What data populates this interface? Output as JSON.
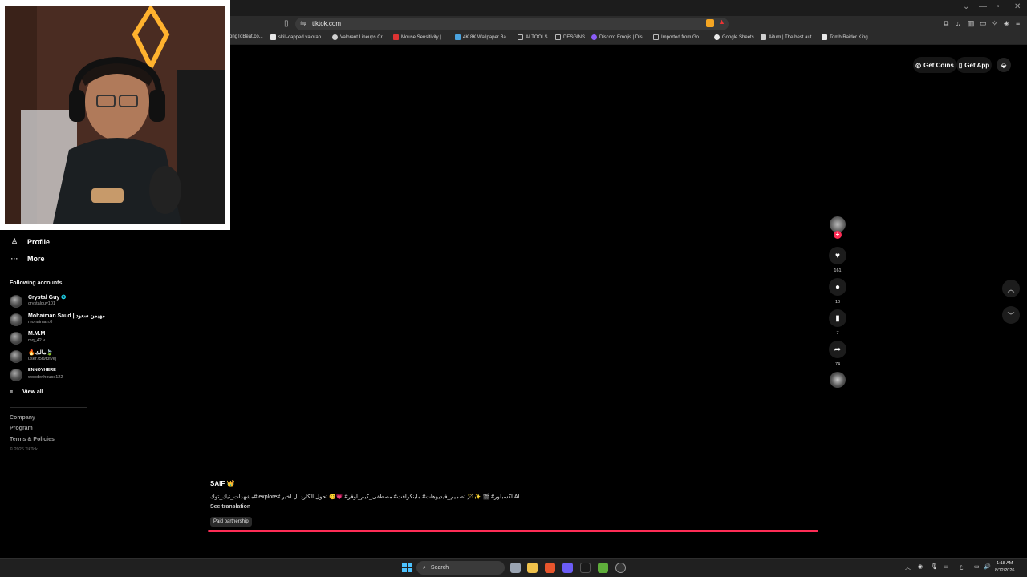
{
  "browser": {
    "url": "tiktok.com",
    "bookmarks": [
      {
        "label": "ongToBeat.co...",
        "color": "#333"
      },
      {
        "label": "skill-capped valoran...",
        "color": "#e8e8e8"
      },
      {
        "label": "Valorant Lineups Cr...",
        "color": "#cfcfcf"
      },
      {
        "label": "Mouse Sensitivity |...",
        "color": "#d33"
      },
      {
        "label": "4K 8K Wallpaper Ba...",
        "color": "#4aa3df"
      },
      {
        "label": "AI TOOLS",
        "color": "#888"
      },
      {
        "label": "DESGINS",
        "color": "#888"
      },
      {
        "label": "Discord Emojis | Dis...",
        "color": "#8a5cf6"
      },
      {
        "label": "Imported from Go...",
        "color": "#888"
      },
      {
        "label": "Google Sheets",
        "color": "#e8e8e8"
      },
      {
        "label": "Aitum | The best aut...",
        "color": "#cfcfcf"
      },
      {
        "label": "Tomb Raider King ...",
        "color": "#e8e8e8"
      }
    ]
  },
  "header": {
    "get_coins": "Get Coins",
    "get_app": "Get App"
  },
  "sidebar": {
    "profile": "Profile",
    "more": "More",
    "following_title": "Following accounts",
    "accounts": [
      {
        "name": "Crystal Guy",
        "username": "crystalguy101",
        "verified": true
      },
      {
        "name": "Mohaiman Saud | مهيمن سعود",
        "username": "mohaiman.0"
      },
      {
        "name": "M.M.M",
        "username": "mq_42.v"
      },
      {
        "name": "🔥مالك🍃",
        "username": "user75r9t3fvej"
      },
      {
        "name": "ENNOYHERE",
        "username": "woodenhouse122"
      }
    ],
    "view_all": "View all",
    "footer": {
      "company": "Company",
      "program": "Program",
      "terms": "Terms & Policies",
      "copyright": "© 2026 TikTok"
    }
  },
  "video": {
    "author": "SAIF 👑",
    "caption": "مشهدات_تيك_توك# explore# اكسبلور# 🎬 ✨🪄 تصميم_فيديوهات# ماينكرافت# مصطفى_كيم_اوفر# 💗😊 تحول الكارد بل اخير AI",
    "see_translation": "See translation",
    "paid_partnership": "Paid partnership",
    "progress_percent": 100,
    "likes": "161",
    "comments": "10",
    "saves": "7",
    "shares": "74"
  },
  "taskbar": {
    "search": "Search",
    "time": "1:18 AM",
    "date": "8/12/2026"
  }
}
